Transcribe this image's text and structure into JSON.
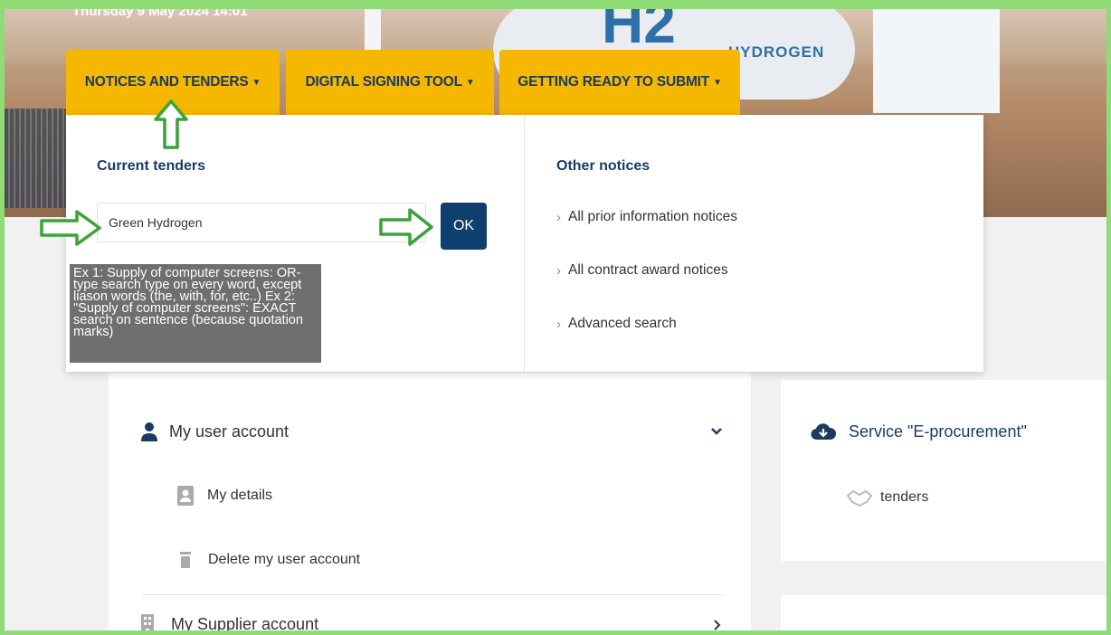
{
  "banner": {
    "date_text": "Thursday 9 May 2024 14:01",
    "logo_text": "H2",
    "logo_word": "HYDROGEN"
  },
  "nav": {
    "tabs": [
      {
        "label": "NOTICES AND TENDERS"
      },
      {
        "label": "DIGITAL SIGNING TOOL"
      },
      {
        "label": "GETTING READY TO SUBMIT"
      }
    ]
  },
  "dropdown": {
    "current_tenders_heading": "Current tenders",
    "search_value": "Green Hydrogen",
    "ok_label": "OK",
    "tooltip": "Ex 1: Supply of computer screens: OR-type search type on every word, except liason words (the, with, for, etc..) Ex 2: \"Supply of computer screens\": EXACT search on sentence (because quotation marks)",
    "other_notices_heading": "Other notices",
    "links": [
      {
        "label": "All prior information notices"
      },
      {
        "label": "All contract award notices"
      },
      {
        "label": "Advanced search"
      }
    ]
  },
  "account_menu": {
    "user_account": "My user account",
    "my_details": "My details",
    "delete_account": "Delete my user account",
    "supplier_account": "My Supplier account"
  },
  "services": {
    "title": "Service \"E-procurement\"",
    "tenders": "tenders"
  },
  "colors": {
    "tab_bg": "#f5b700",
    "tab_text": "#1c3b63",
    "ok_button": "#0e3f6e",
    "annotation_arrow": "#3aa33a",
    "frame_border": "#8fdc77"
  }
}
